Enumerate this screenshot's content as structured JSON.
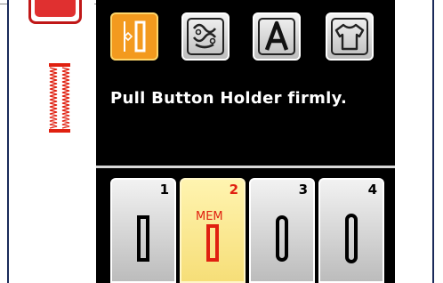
{
  "mode_tabs": [
    {
      "icon": "utility-stitch-icon",
      "active": true
    },
    {
      "icon": "decorative-stitch-icon",
      "active": false
    },
    {
      "icon": "character-stitch-icon",
      "active": false,
      "label": "A"
    },
    {
      "icon": "garment-icon",
      "active": false
    }
  ],
  "message": "Pull Button Holder firmly.",
  "stitch_keys": [
    {
      "number": "1",
      "selected": false,
      "icon": "buttonhole-square-icon"
    },
    {
      "number": "2",
      "selected": true,
      "badge": "MEM",
      "icon": "buttonhole-square-icon"
    },
    {
      "number": "3",
      "selected": false,
      "icon": "buttonhole-round-icon"
    },
    {
      "number": "4",
      "selected": false,
      "icon": "buttonhole-keyhole-icon"
    }
  ],
  "colors": {
    "active_tab": "#f39a1e",
    "selected_key": "#f6de78",
    "alert_red": "#e02010",
    "screen_bg": "#000000"
  }
}
